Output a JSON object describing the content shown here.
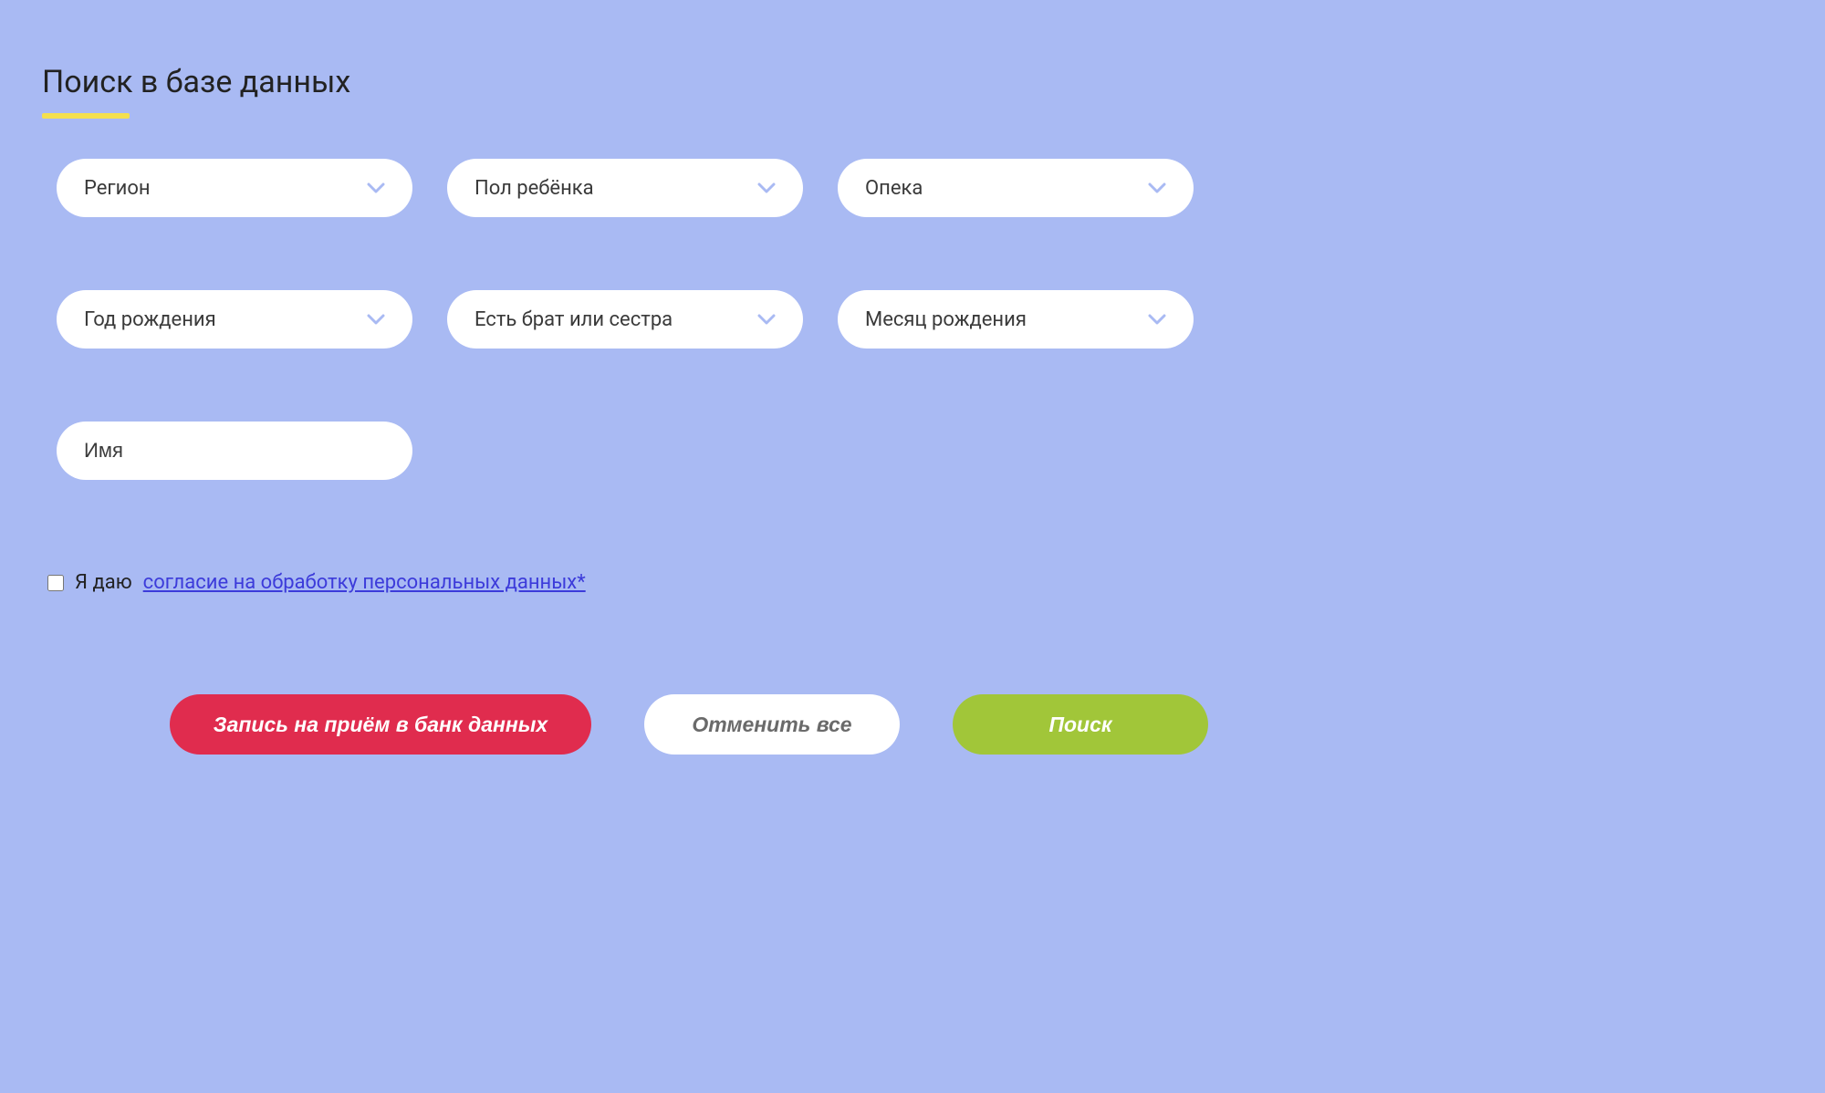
{
  "header": {
    "title": "Поиск в базе данных"
  },
  "filters": {
    "region": {
      "label": "Регион"
    },
    "gender": {
      "label": "Пол ребёнка"
    },
    "guardianship": {
      "label": "Опека"
    },
    "birth_year": {
      "label": "Год рождения"
    },
    "siblings": {
      "label": "Есть брат или сестра"
    },
    "birth_month": {
      "label": "Месяц рождения"
    },
    "name": {
      "placeholder": "Имя"
    }
  },
  "consent": {
    "prefix": "Я даю ",
    "link_text": "согласие на обработку персональных данных*"
  },
  "buttons": {
    "appointment": "Запись на приём в банк данных",
    "reset": "Отменить все",
    "search": "Поиск"
  },
  "colors": {
    "background": "#a9baf3",
    "accent_yellow": "#f4e04d",
    "primary_red": "#e02c4e",
    "primary_green": "#a1c639",
    "link": "#3c3bda",
    "chevron": "#a9baf3"
  }
}
